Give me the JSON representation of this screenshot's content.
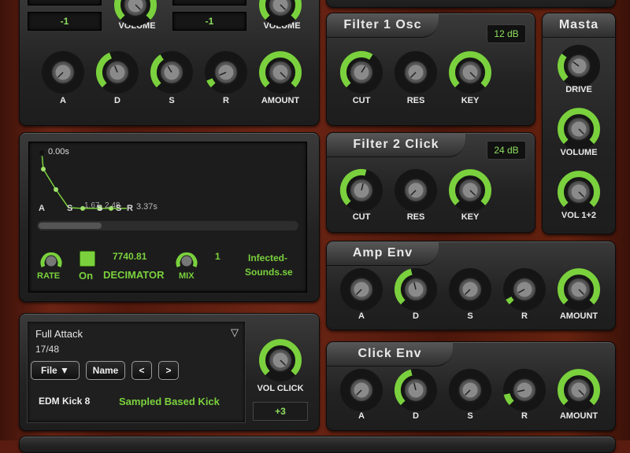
{
  "top": {
    "osc1_value": "-1",
    "osc1_volume_label": "VOLUME",
    "osc2_value": "-1",
    "osc2_volume_label": "VOLUME"
  },
  "pitch_env": {
    "knobs": [
      {
        "label": "A",
        "value": 0
      },
      {
        "label": "D",
        "value": 0.42
      },
      {
        "label": "S",
        "value": 0.38
      },
      {
        "label": "R",
        "value": 0.08
      },
      {
        "label": "AMOUNT",
        "value": 1
      }
    ]
  },
  "decimator": {
    "env_readout": {
      "start_time": "0.00s",
      "mid_time": "1.67",
      "mid_time_b": "2.48",
      "end_time": "3.37s",
      "point_labels": [
        "A",
        "S",
        "S",
        "S",
        "R"
      ]
    },
    "rate_label": "RATE",
    "on_label": "On",
    "value_rate": "7740.81",
    "title": "DECIMATOR",
    "mix_label": "MIX",
    "value_mix": "1",
    "credit_line1": "Infected-",
    "credit_line2": "Sounds.se"
  },
  "sample": {
    "preset_name": "Full Attack",
    "dropdown_icon": "▽",
    "counter": "17/48",
    "file_button": "File ▼",
    "name_button": "Name",
    "prev_button": "<",
    "next_button": ">",
    "kick_name": "EDM Kick 8",
    "kick_type": "Sampled Based Kick",
    "vol_click_label": "VOL CLICK",
    "vol_click_value": 1,
    "click_offset": "+3"
  },
  "filter1": {
    "title": "Filter 1 Osc",
    "slope": "12 dB",
    "knobs": [
      {
        "label": "CUT",
        "value": 0.62
      },
      {
        "label": "RES",
        "value": 0
      },
      {
        "label": "KEY",
        "value": 1
      }
    ]
  },
  "filter2": {
    "title": "Filter 2 Click",
    "slope": "24 dB",
    "knobs": [
      {
        "label": "CUT",
        "value": 0.55
      },
      {
        "label": "RES",
        "value": 0
      },
      {
        "label": "KEY",
        "value": 1
      }
    ]
  },
  "master": {
    "title": "Masta",
    "knobs": [
      {
        "label": "DRIVE",
        "value": 0.3
      },
      {
        "label": "VOLUME",
        "value": 1
      },
      {
        "label": "VOL 1+2",
        "value": 1
      }
    ]
  },
  "amp_env": {
    "title": "Amp Env",
    "knobs": [
      {
        "label": "A",
        "value": 0
      },
      {
        "label": "D",
        "value": 0.45
      },
      {
        "label": "S",
        "value": 0
      },
      {
        "label": "R",
        "value": 0.06
      },
      {
        "label": "AMOUNT",
        "value": 1
      }
    ]
  },
  "click_env": {
    "title": "Click Env",
    "knobs": [
      {
        "label": "A",
        "value": 0
      },
      {
        "label": "D",
        "value": 0.45
      },
      {
        "label": "S",
        "value": 0
      },
      {
        "label": "R",
        "value": 0.12
      },
      {
        "label": "AMOUNT",
        "value": 1
      }
    ]
  },
  "colors": {
    "accent": "#7ad13d",
    "panel": "#262626",
    "wood": "#5a1c10"
  }
}
